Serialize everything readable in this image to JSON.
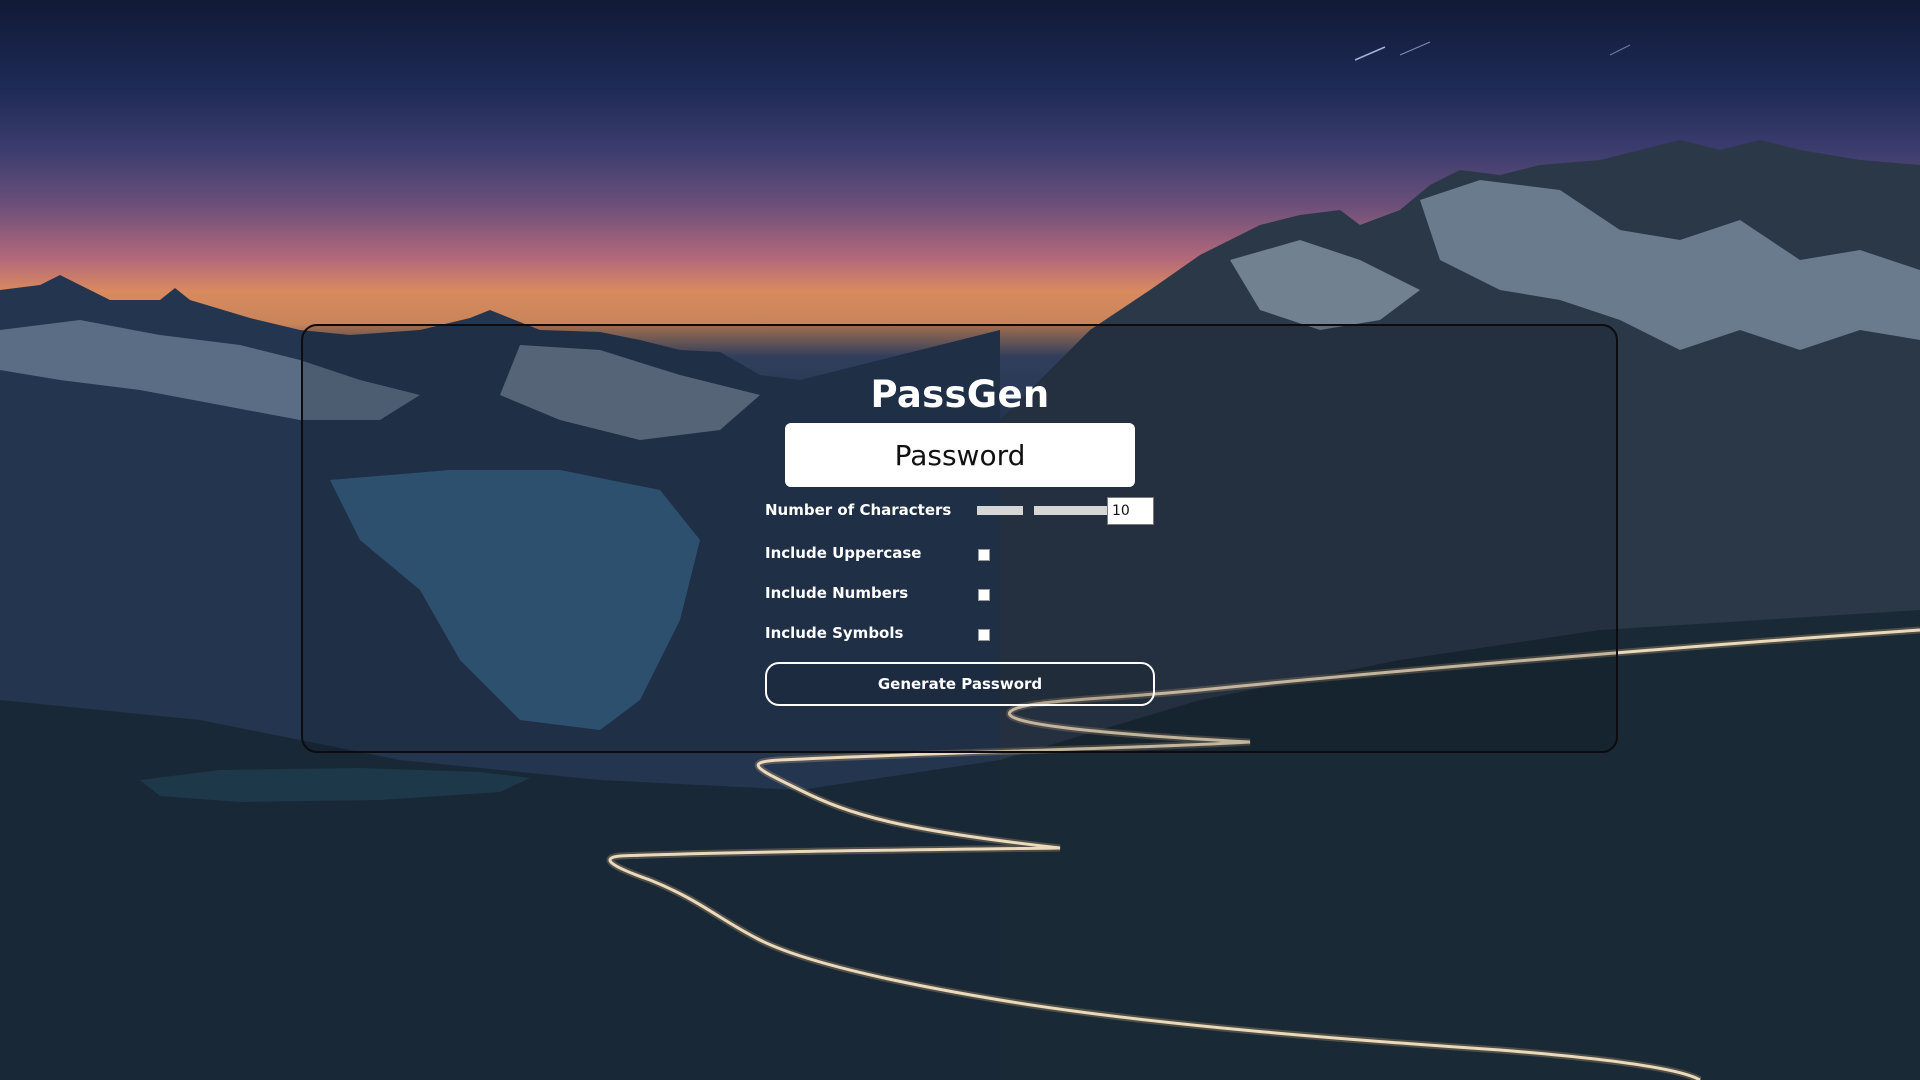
{
  "app": {
    "title": "PassGen"
  },
  "password_display": {
    "value": "Password"
  },
  "options": {
    "length_label": "Number of Characters",
    "length_value": "10",
    "uppercase_label": "Include Uppercase",
    "uppercase_checked": false,
    "numbers_label": "Include Numbers",
    "numbers_checked": false,
    "symbols_label": "Include Symbols",
    "symbols_checked": false
  },
  "actions": {
    "generate_label": "Generate Password"
  },
  "background": {
    "description_icon": "mountain-night-landscape",
    "colors": {
      "sky_top": "#111a36",
      "sunset": "#d98a5f",
      "valley": "#16283c"
    }
  }
}
